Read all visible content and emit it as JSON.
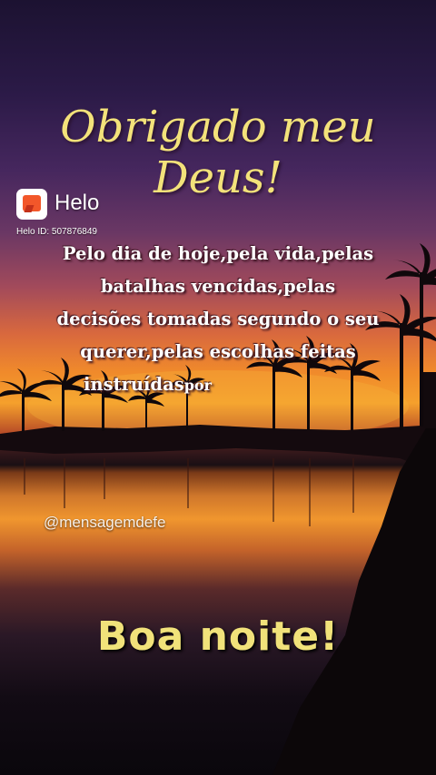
{
  "card": {
    "title": "Obrigado meu Deus!",
    "message_lines": [
      "Pelo dia de hoje,pela vida,pelas",
      "batalhas vencidas,pelas",
      "decisões tomadas segundo o seu",
      "querer,pelas escolhas feitas",
      "instruídas"
    ],
    "message_tail": "por",
    "handle": "@mensagemdefe",
    "greeting": "Boa noite!"
  },
  "watermark": {
    "app_name": "Helo",
    "app_id": "Helo ID: 507876849",
    "logo_icon": "helo-logo-icon"
  },
  "colors": {
    "title": "#f3e27a",
    "greeting": "#f1e27a",
    "logo_bg": "#ffffff",
    "logo_mark": "#f2572a"
  }
}
